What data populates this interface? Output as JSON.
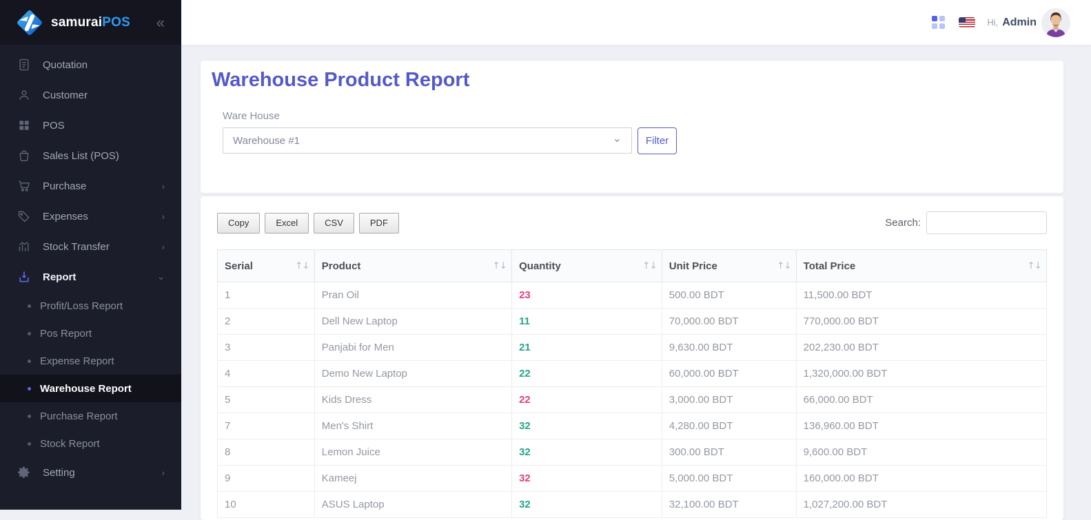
{
  "brand": {
    "name_left": "samurai",
    "name_right": "POS",
    "collapse_icon": "«"
  },
  "sidebar": {
    "items": [
      {
        "label": "Quotation",
        "icon": "quotation-icon",
        "arrow": ""
      },
      {
        "label": "Customer",
        "icon": "customer-icon",
        "arrow": ""
      },
      {
        "label": "POS",
        "icon": "pos-icon",
        "arrow": ""
      },
      {
        "label": "Sales List (POS)",
        "icon": "sales-list-icon",
        "arrow": ""
      },
      {
        "label": "Purchase",
        "icon": "purchase-icon",
        "arrow": "›"
      },
      {
        "label": "Expenses",
        "icon": "expenses-icon",
        "arrow": "›"
      },
      {
        "label": "Stock Transfer",
        "icon": "stock-transfer-icon",
        "arrow": "›"
      },
      {
        "label": "Report",
        "icon": "report-icon",
        "arrow": "⌄",
        "active": true,
        "children": [
          "Profit/Loss Report",
          "Pos Report",
          "Expense Report",
          "Warehouse Report",
          "Purchase Report",
          "Stock Report"
        ],
        "active_child": "Warehouse Report"
      },
      {
        "label": "Setting",
        "icon": "setting-icon",
        "arrow": "›"
      }
    ]
  },
  "topbar": {
    "hi": "Hi,",
    "username": "Admin"
  },
  "page": {
    "title": "Warehouse Product Report"
  },
  "filter": {
    "field_label": "Ware House",
    "selected_value": "Warehouse #1",
    "button_label": "Filter"
  },
  "toolbar": {
    "buttons": [
      "Copy",
      "Excel",
      "CSV",
      "PDF"
    ],
    "search_label": "Search:"
  },
  "table": {
    "columns": [
      "Serial",
      "Product",
      "Quantity",
      "Unit Price",
      "Total Price"
    ],
    "rows": [
      {
        "serial": "1",
        "product": "Pran Oil",
        "quantity": "23",
        "qty_color": "pink",
        "unit_price": "500.00 BDT",
        "total_price": "11,500.00 BDT"
      },
      {
        "serial": "2",
        "product": "Dell New Laptop",
        "quantity": "11",
        "qty_color": "green",
        "unit_price": "70,000.00 BDT",
        "total_price": "770,000.00 BDT"
      },
      {
        "serial": "3",
        "product": "Panjabi for Men",
        "quantity": "21",
        "qty_color": "green",
        "unit_price": "9,630.00 BDT",
        "total_price": "202,230.00 BDT"
      },
      {
        "serial": "4",
        "product": "Demo New Laptop",
        "quantity": "22",
        "qty_color": "green",
        "unit_price": "60,000.00 BDT",
        "total_price": "1,320,000.00 BDT"
      },
      {
        "serial": "5",
        "product": "Kids Dress",
        "quantity": "22",
        "qty_color": "pink",
        "unit_price": "3,000.00 BDT",
        "total_price": "66,000.00 BDT"
      },
      {
        "serial": "7",
        "product": "Men's Shirt",
        "quantity": "32",
        "qty_color": "green",
        "unit_price": "4,280.00 BDT",
        "total_price": "136,960.00 BDT"
      },
      {
        "serial": "8",
        "product": "Lemon Juice",
        "quantity": "32",
        "qty_color": "green",
        "unit_price": "300.00 BDT",
        "total_price": "9,600.00 BDT"
      },
      {
        "serial": "9",
        "product": "Kameej",
        "quantity": "32",
        "qty_color": "pink",
        "unit_price": "5,000.00 BDT",
        "total_price": "160,000.00 BDT"
      },
      {
        "serial": "10",
        "product": "ASUS Laptop",
        "quantity": "32",
        "qty_color": "green",
        "unit_price": "32,100.00 BDT",
        "total_price": "1,027,200.00 BDT"
      }
    ]
  },
  "colors": {
    "accent": "#5459cb",
    "brand_blue": "#2d9cf4",
    "qty_pink": "#e23e80",
    "qty_green": "#27a38a",
    "sidebar_bg": "#1b1d2a"
  }
}
